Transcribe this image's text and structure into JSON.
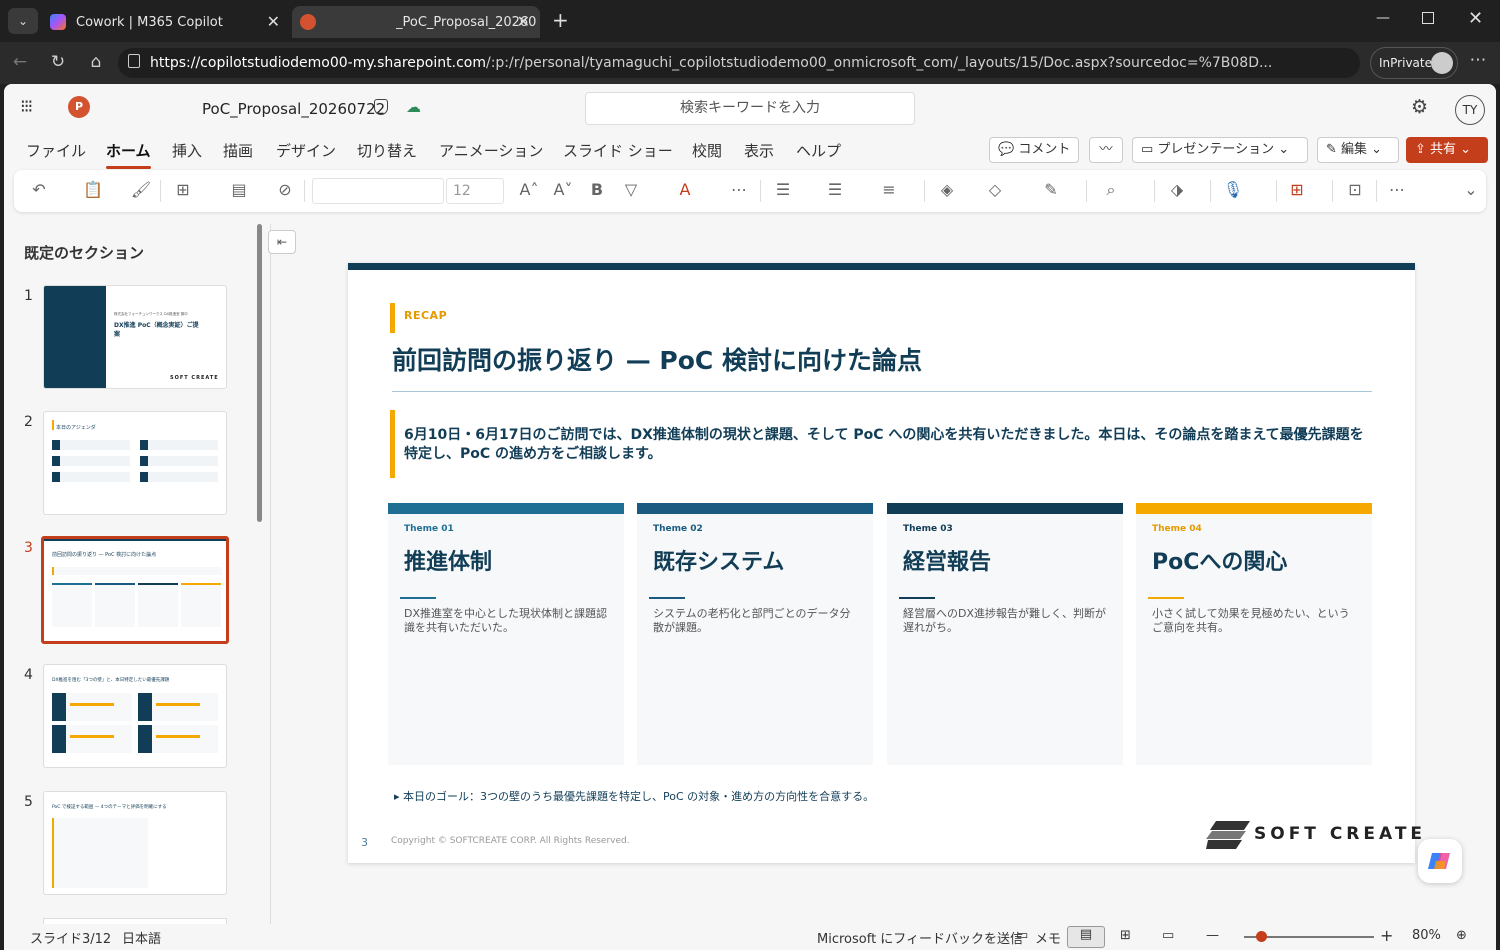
{
  "browser": {
    "tabs": [
      {
        "label": "Cowork | M365 Copilot"
      },
      {
        "label": "_PoC_Proposal_20260"
      }
    ],
    "url_host": "https://copilotstudiodemo00-my.sharepoint.com",
    "url_path": "/:p:/r/personal/tyamaguchi_copilotstudiodemo00_onmicrosoft_com/_layouts/15/Doc.aspx?sourcedoc=%7B08D...",
    "inprivate_label": "InPrivate"
  },
  "app": {
    "doc_title": "PoC_Proposal_20260722",
    "search_placeholder": "検索キーワードを入力",
    "user_initials": "TY"
  },
  "menu": {
    "items": [
      "ファイル",
      "ホーム",
      "挿入",
      "描画",
      "デザイン",
      "切り替え",
      "アニメーション",
      "スライド ショー",
      "校閲",
      "表示",
      "ヘルプ"
    ],
    "active": "ホーム",
    "comment_label": "コメント",
    "present_label": "プレゼンテーション",
    "edit_label": "編集",
    "share_label": "共有"
  },
  "ribbon": {
    "font_size": "12"
  },
  "panel": {
    "section_title": "既定のセクション",
    "slide_numbers": [
      "1",
      "2",
      "3",
      "4",
      "5"
    ],
    "selected": "3",
    "thumb1": {
      "line1": "株式会社フォーチュンワークス DX推進室 御中",
      "title": "DX推進 PoC（概念実証）ご提案",
      "logo": "SOFT CREATE"
    },
    "thumb2": {
      "title": "本日のアジェンダ"
    },
    "thumb3": {
      "title": "前回訪問の振り返り — PoC 検討に向けた論点"
    },
    "thumb4": {
      "title": "DX推進を阻む「3つの壁」と、本日特定したい最優先課題"
    },
    "thumb5": {
      "title": "PoC で検証する範囲 — 4つのテーマと評価を明確にする"
    }
  },
  "slide": {
    "recap": "RECAP",
    "title": "前回訪問の振り返り — PoC 検討に向けた論点",
    "intro": "6月10日・6月17日のご訪問では、DX推進体制の現状と課題、そして PoC への関心を共有いただきました。本日は、その論点を踏まえて最優先課題を特定し、PoC の進め方をご相談します。",
    "cards": [
      {
        "theme": "Theme 01",
        "heading": "推進体制",
        "desc": "DX推進室を中心とした現状体制と課題認識を共有いただいた。",
        "color": "#1f6f95"
      },
      {
        "theme": "Theme 02",
        "heading": "既存システム",
        "desc": "システムの老朽化と部門ごとのデータ分散が課題。",
        "color": "#1a5a80"
      },
      {
        "theme": "Theme 03",
        "heading": "経営報告",
        "desc": "経営層へのDX進捗報告が難しく、判断が遅れがち。",
        "color": "#123d57"
      },
      {
        "theme": "Theme 04",
        "heading": "PoCへの関心",
        "desc": "小さく試して効果を見極めたい、というご意向を共有。",
        "color": "#f5a800"
      }
    ],
    "goal": "▸ 本日のゴール：3つの壁のうち最優先課題を特定し、PoC の対象・進め方の方向性を合意する。",
    "page_number": "3",
    "copyright": "Copyright © SOFTCREATE CORP. All Rights Reserved.",
    "logo_text": "SOFT CREATE"
  },
  "status": {
    "slide_counter": "スライド3/12",
    "language": "日本語",
    "feedback": "Microsoft にフィードバックを送信",
    "notes": "メモ",
    "zoom": "80%"
  }
}
